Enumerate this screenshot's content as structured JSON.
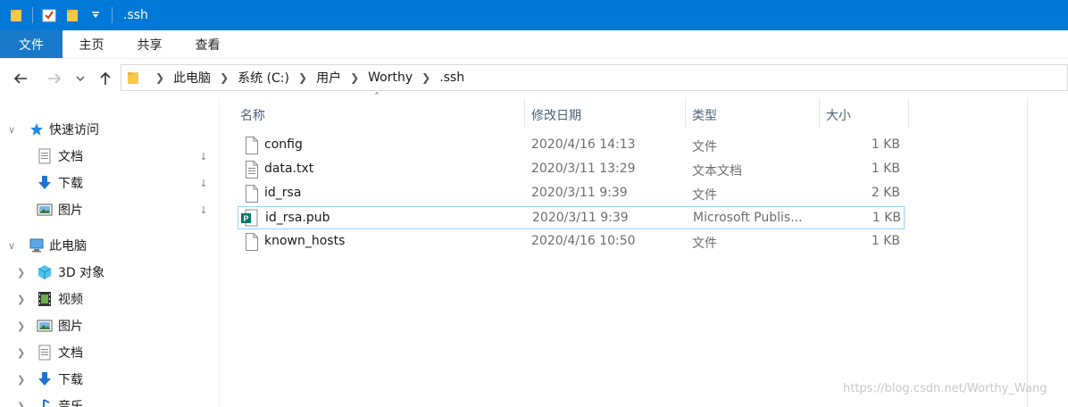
{
  "window": {
    "title": ".ssh",
    "qat_icons": [
      "folder-icon",
      "properties-icon",
      "new-folder-icon",
      "customize-dropdown-icon"
    ]
  },
  "ribbon": {
    "tabs": [
      {
        "label": "文件",
        "active": true
      },
      {
        "label": "主页"
      },
      {
        "label": "共享"
      },
      {
        "label": "查看"
      }
    ]
  },
  "nav": {
    "back_icon": "back-arrow-icon",
    "forward_icon": "forward-arrow-icon",
    "recent_icon": "chevron-down-icon",
    "up_icon": "up-arrow-icon"
  },
  "address": {
    "crumbs": [
      "此电脑",
      "系统 (C:)",
      "用户",
      "Worthy",
      ".ssh"
    ]
  },
  "sidebar": {
    "quick_access": {
      "label": "快速访问",
      "items": [
        {
          "label": "文档",
          "icon": "documents-icon",
          "pinned": true
        },
        {
          "label": "下载",
          "icon": "downloads-icon",
          "pinned": true
        },
        {
          "label": "图片",
          "icon": "pictures-icon",
          "pinned": true
        }
      ]
    },
    "this_pc": {
      "label": "此电脑",
      "items": [
        {
          "label": "3D 对象",
          "icon": "3d-objects-icon"
        },
        {
          "label": "视频",
          "icon": "videos-icon"
        },
        {
          "label": "图片",
          "icon": "pictures-icon"
        },
        {
          "label": "文档",
          "icon": "documents-icon"
        },
        {
          "label": "下载",
          "icon": "downloads-icon"
        },
        {
          "label": "音乐",
          "icon": "music-icon"
        }
      ]
    }
  },
  "columns": {
    "name": "名称",
    "date": "修改日期",
    "type": "类型",
    "size": "大小"
  },
  "files": [
    {
      "name": "config",
      "date": "2020/4/16 14:13",
      "type": "文件",
      "size": "1 KB",
      "icon": "file-icon"
    },
    {
      "name": "data.txt",
      "date": "2020/3/11 13:29",
      "type": "文本文档",
      "size": "1 KB",
      "icon": "text-file-icon"
    },
    {
      "name": "id_rsa",
      "date": "2020/3/11 9:39",
      "type": "文件",
      "size": "2 KB",
      "icon": "file-icon"
    },
    {
      "name": "id_rsa.pub",
      "date": "2020/3/11 9:39",
      "type": "Microsoft Publis...",
      "size": "1 KB",
      "icon": "publisher-file-icon",
      "selected": true
    },
    {
      "name": "known_hosts",
      "date": "2020/4/16 10:50",
      "type": "文件",
      "size": "1 KB",
      "icon": "file-icon"
    }
  ],
  "watermark": "https://blog.csdn.net/Worthy_Wang",
  "colors": {
    "titlebar": "#0078d7",
    "file_tab": "#1979ca",
    "selection_border": "#99d1ff"
  }
}
